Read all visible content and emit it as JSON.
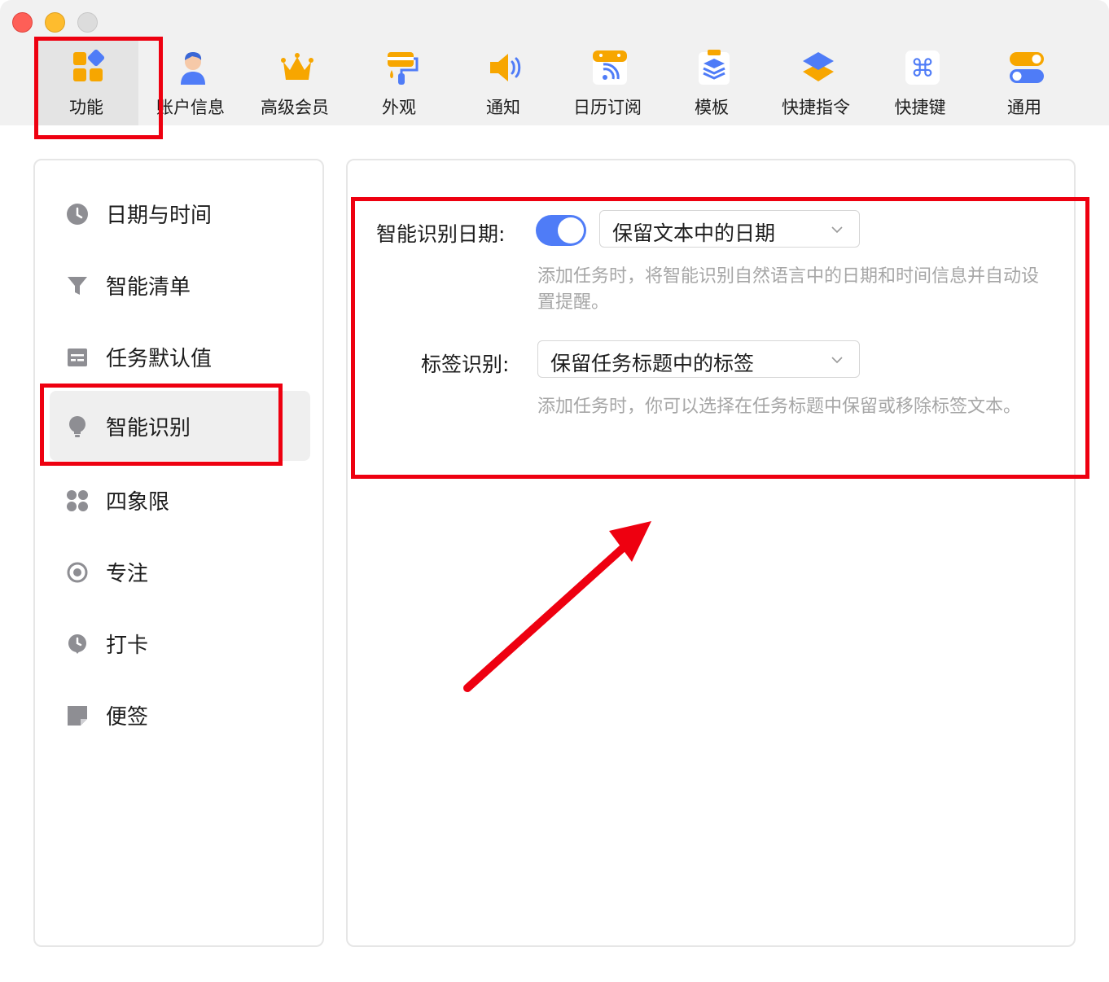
{
  "window": {
    "controls": [
      "close-button",
      "minimize-button",
      "zoom-button"
    ]
  },
  "tabs": [
    {
      "label": "功能",
      "icon": "grid-icon",
      "active": true
    },
    {
      "label": "账户信息",
      "icon": "user-icon",
      "active": false
    },
    {
      "label": "高级会员",
      "icon": "crown-icon",
      "active": false
    },
    {
      "label": "外观",
      "icon": "paint-roller-icon",
      "active": false
    },
    {
      "label": "通知",
      "icon": "speaker-icon",
      "active": false
    },
    {
      "label": "日历订阅",
      "icon": "calendar-rss-icon",
      "active": false
    },
    {
      "label": "模板",
      "icon": "template-layers-icon",
      "active": false
    },
    {
      "label": "快捷指令",
      "icon": "shortcuts-icon",
      "active": false
    },
    {
      "label": "快捷键",
      "icon": "command-key-icon",
      "active": false
    },
    {
      "label": "通用",
      "icon": "toggles-icon",
      "active": false
    }
  ],
  "sidebar": {
    "items": [
      {
        "label": "日期与时间",
        "icon": "clock-icon",
        "active": false
      },
      {
        "label": "智能清单",
        "icon": "filter-icon",
        "active": false
      },
      {
        "label": "任务默认值",
        "icon": "form-icon",
        "active": false
      },
      {
        "label": "智能识别",
        "icon": "lightbulb-icon",
        "active": true
      },
      {
        "label": "四象限",
        "icon": "four-squares-icon",
        "active": false
      },
      {
        "label": "专注",
        "icon": "target-icon",
        "active": false
      },
      {
        "label": "打卡",
        "icon": "checkin-icon",
        "active": false
      },
      {
        "label": "便签",
        "icon": "sticky-note-icon",
        "active": false
      }
    ]
  },
  "settings": {
    "date_recognition": {
      "label": "智能识别日期:",
      "enabled": true,
      "select_value": "保留文本中的日期",
      "description": "添加任务时，将智能识别自然语言中的日期和时间信息并自动设置提醒。"
    },
    "tag_recognition": {
      "label": "标签识别:",
      "select_value": "保留任务标题中的标签",
      "description": "添加任务时，你可以选择在任务标题中保留或移除标签文本。"
    }
  },
  "colors": {
    "accent": "#4f7cf7",
    "annotation_red": "#ee0010",
    "orange": "#f7a600",
    "blue": "#4f7cf7"
  }
}
